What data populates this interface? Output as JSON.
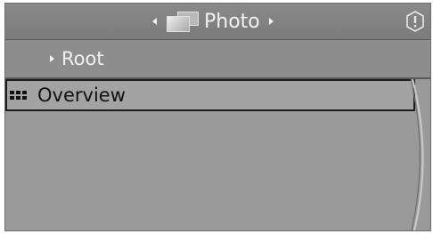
{
  "header": {
    "title": "Photo",
    "title_icon": "photo-icon",
    "left_arrow_icon": "chevron-left-icon",
    "right_arrow_icon": "chevron-right-icon",
    "info_icon": "info-icon"
  },
  "breadcrumb": {
    "label": "Root",
    "arrow_icon": "chevron-right-icon"
  },
  "list": {
    "items": [
      {
        "label": "Overview",
        "icon": "grid-icon",
        "selected": true
      }
    ]
  },
  "colors": {
    "screen_bg": "#9a9a9a",
    "header_bg": "#7b7b7b",
    "selection_border": "#1c1c1c",
    "text_light": "#f2f2f2"
  }
}
